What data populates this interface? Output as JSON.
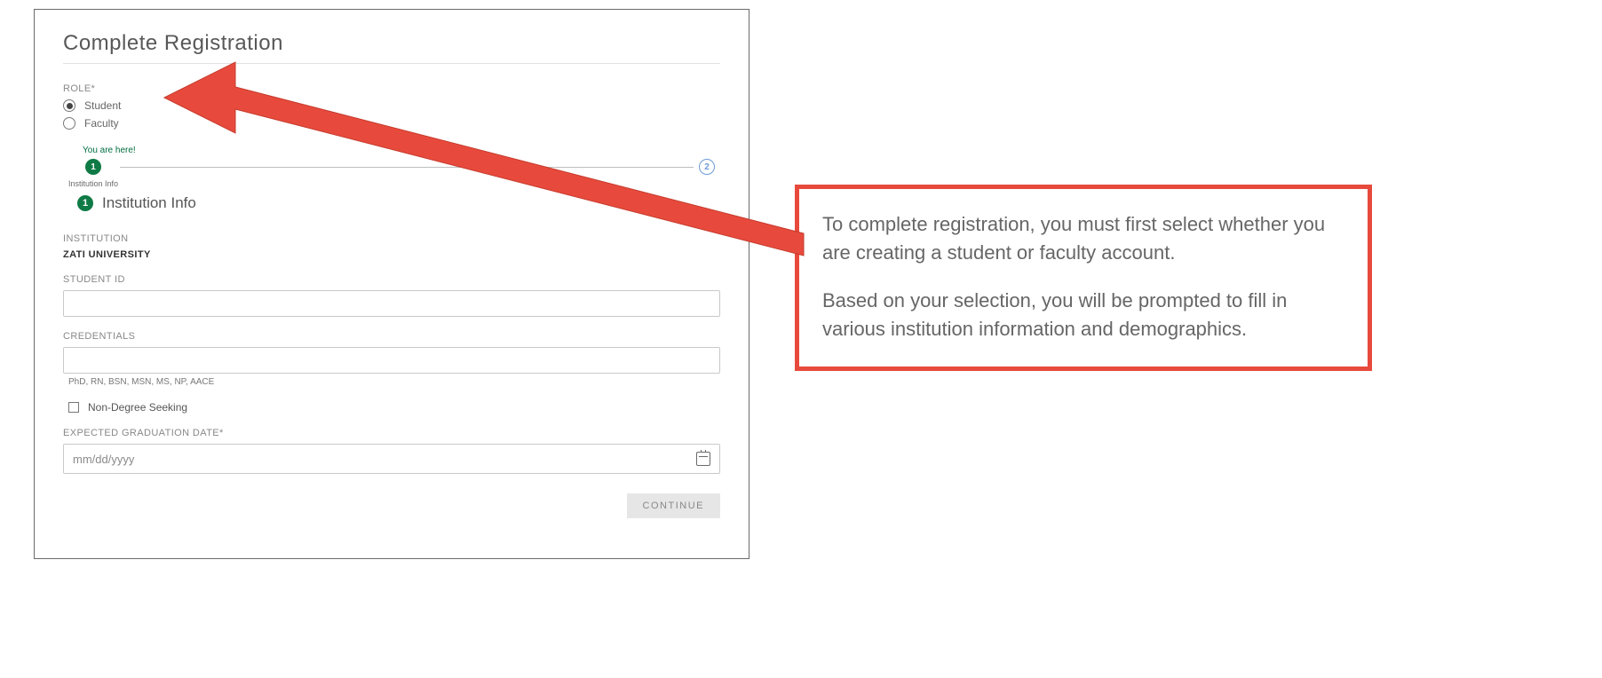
{
  "page": {
    "title": "Complete Registration",
    "role_label": "ROLE*",
    "role_options": {
      "student": "Student",
      "faculty": "Faculty"
    },
    "you_are_here": "You are here!",
    "stepper": {
      "step1_num": "1",
      "step1_label": "Institution Info",
      "step2_num": "2"
    },
    "section": {
      "num": "1",
      "title": "Institution Info"
    },
    "institution_label": "INSTITUTION",
    "institution_value": "ZATI UNIVERSITY",
    "student_id_label": "STUDENT ID",
    "credentials_label": "CREDENTIALS",
    "credentials_helper": "PhD, RN, BSN, MSN, MS, NP, AACE",
    "non_degree_label": "Non-Degree Seeking",
    "grad_date_label": "EXPECTED GRADUATION DATE*",
    "grad_date_placeholder": "mm/dd/yyyy",
    "continue_label": "CONTINUE"
  },
  "callout": {
    "p1": "To complete registration, you must first select whether you are creating a student or faculty account.",
    "p2": "Based on your selection, you will be prompted to fill in various institution information and demographics."
  }
}
